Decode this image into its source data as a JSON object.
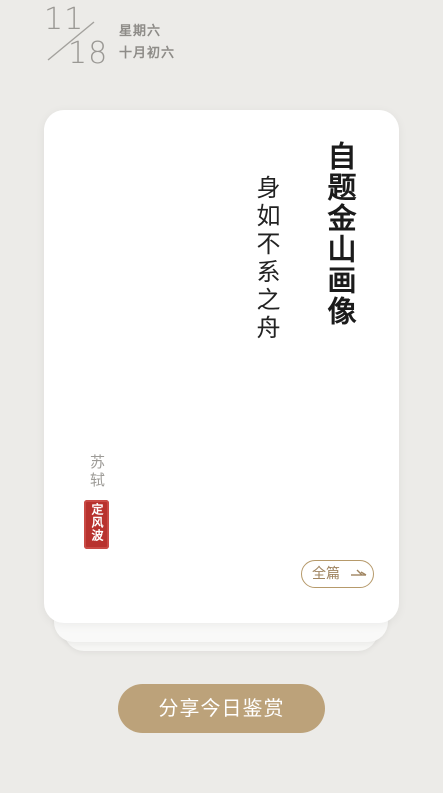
{
  "date": {
    "day": "11",
    "month_day": "18",
    "weekday": "星期六",
    "lunar": "十月初六"
  },
  "poem": {
    "title": "自题金山画像",
    "verse": "身如不系之舟",
    "author": "苏轼",
    "seal_text": "定风波"
  },
  "actions": {
    "full_text_label": "全篇",
    "share_label": "分享今日鉴赏"
  },
  "icons": {
    "full_text_icon": "arrow-right-icon",
    "slash_icon": "date-divider-icon"
  },
  "colors": {
    "accent_gold": "#bca27a",
    "seal_red": "#b8322e",
    "background": "#ecebe8"
  }
}
